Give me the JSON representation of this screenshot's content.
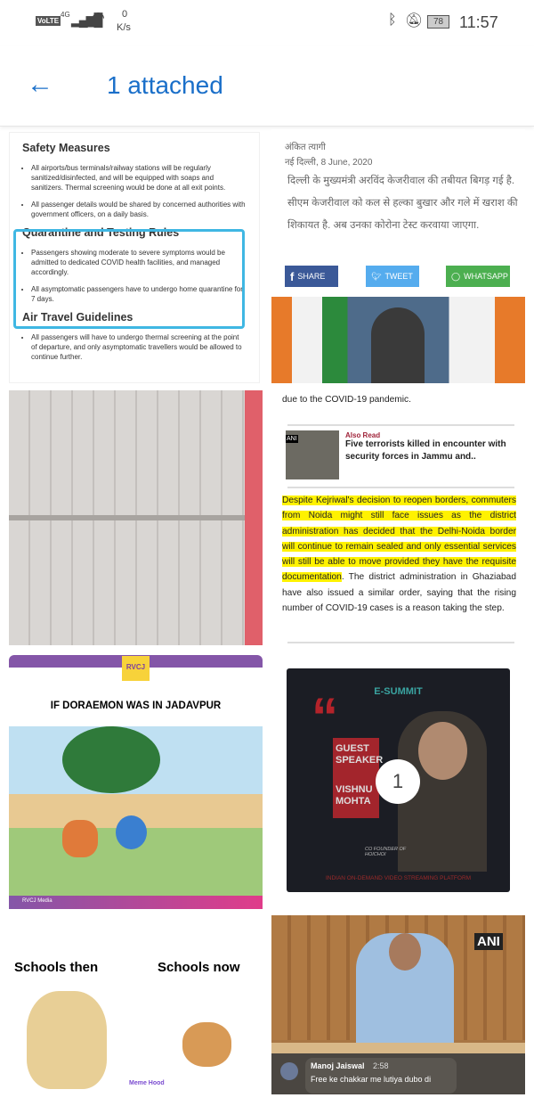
{
  "status_bar": {
    "volte": "VoLTE",
    "network": "4G",
    "speed_value": "0",
    "speed_unit": "K/s",
    "battery": "78",
    "time": "11:57"
  },
  "header": {
    "title": "1 attached",
    "back_icon": "arrow-left-icon"
  },
  "tiles": {
    "doc": {
      "h1": "Safety Measures",
      "b1": [
        "All airports/bus terminals/railway stations will be regularly sanitized/disinfected, and will be equipped with soaps and sanitizers. Thermal screening would be done at all exit points.",
        "All passenger details would be shared by concerned authorities with government officers, on a daily basis."
      ],
      "h2": "Quarantine and Testing Rules",
      "b2": [
        "Passengers showing moderate to severe symptoms would be admitted to dedicated COVID health facilities, and managed accordingly.",
        "All asymptomatic passengers have to undergo home quarantine for 7 days."
      ],
      "h3": "Air Travel Guidelines",
      "b3": [
        "All passengers will have to undergo thermal screening at the point of departure, and only asymptomatic travellers would be allowed to continue further."
      ]
    },
    "hindi": {
      "author": "अंकित त्यागी",
      "dateline": "नई दिल्ली, 8 June, 2020",
      "body": "दिल्ली के मुख्यमंत्री अरविंद केजरीवाल की तबीयत बिगड़ गई है. सीएम केजरीवाल को कल से हल्का बुखार और गले में खराश की शिकायत है. अब उनका कोरोना टेस्ट करवाया जाएगा.",
      "share": "SHARE",
      "tweet": "TWEET",
      "whatsapp": "WHATSAPP"
    },
    "eng": {
      "top": "due to the COVID-19 pandemic.",
      "also_read": "Also Read",
      "also_title": "Five terrorists killed in encounter with security forces in Jammu and..",
      "ani": "ANI",
      "highlight": "Despite Kejriwal's decision to reopen borders, commuters from Noida might still face issues as the district administration has decided that the Delhi-Noida border will continue to remain sealed and only essential services will still be able to move provided they have the requisite documentation",
      "rest": ". The district administration in Ghaziabad have also issued a similar order, saying that the rising number of COVID-19 cases is a reason taking the step."
    },
    "dora": {
      "logo": "RVCJ",
      "title": "IF DORAEMON WAS IN JADAVPUR",
      "footer": "RVCJ Media"
    },
    "summit": {
      "logo": "E-SUMMIT",
      "guest": "GUEST SPEAKER",
      "name": "VISHNU MOHTA",
      "role": "CO FOUNDER OF HOICHOI",
      "tag": "INDIAN ON-DEMAND VIDEO STREAMING PLATFORM",
      "selection_count": "1"
    },
    "meme": {
      "left": "Schools then",
      "right": "Schools now",
      "wm": "Meme Hood"
    },
    "kej": {
      "ani": "ANI",
      "commenter": "Manoj Jaiswal",
      "time": "2:58",
      "comment": "Free ke chakkar me lutiya dubo di"
    }
  },
  "colors": {
    "accent": "#1a6fc9",
    "highlight": "#fff200",
    "facebook": "#3b5998",
    "twitter": "#55acee",
    "whatsapp": "#4caf50"
  }
}
